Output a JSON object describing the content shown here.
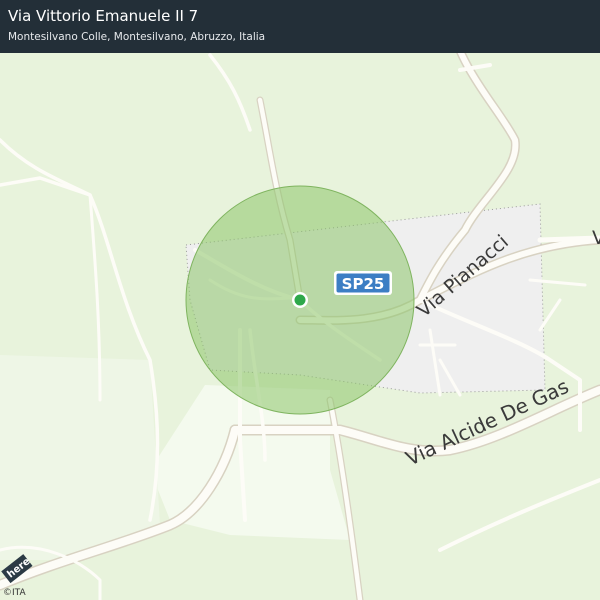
{
  "header": {
    "title": "Via Vittorio Emanuele II 7",
    "subtitle": "Montesilvano Colle, Montesilvano, Abruzzo, Italia"
  },
  "map": {
    "road_shield": "SP25",
    "labels": {
      "via_pianacci": "Via Pianacci",
      "via_alcide": "Via   Alcide   De   Gas",
      "via_edge": "V"
    },
    "here_logo": "here",
    "attribution": "©ITA",
    "colors": {
      "land": "#e8f3dc",
      "road": "#ffffff",
      "road_casing": "#d8d2c2",
      "urban": "#efefef",
      "accuracy_circle": "#8dc46a",
      "location_dot": "#2ea84a",
      "shield": "#3c7ec4",
      "header_bg": "#232f38"
    },
    "icons": [
      "location-dot-icon",
      "road-shield-icon"
    ]
  }
}
